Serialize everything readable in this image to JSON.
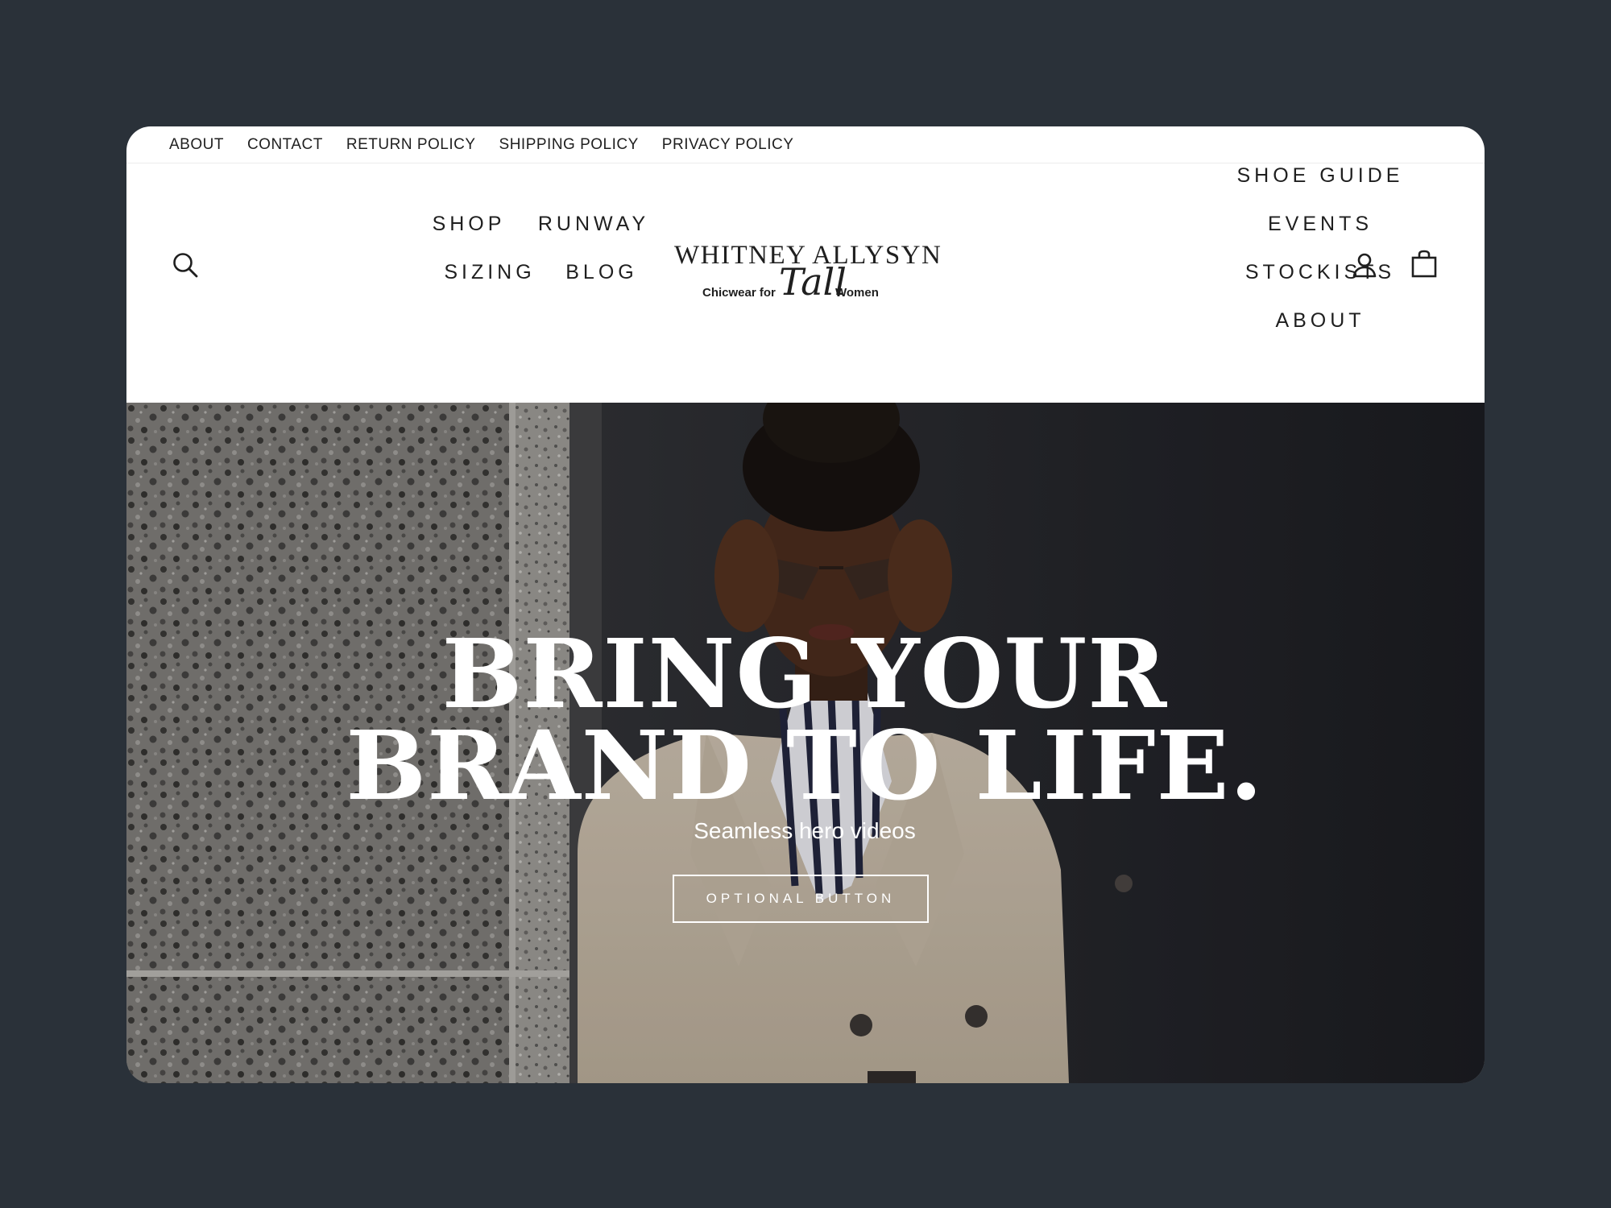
{
  "utility_nav": {
    "items": [
      "ABOUT",
      "CONTACT",
      "RETURN POLICY",
      "SHIPPING POLICY",
      "PRIVACY POLICY"
    ]
  },
  "header": {
    "left_nav": [
      "SHOP",
      "RUNWAY",
      "SIZING",
      "BLOG"
    ],
    "right_nav": [
      "SHOE GUIDE",
      "EVENTS",
      "STOCKISTS",
      "ABOUT"
    ],
    "logo": {
      "name": "WHITNEY ALLYSYN",
      "tagline_left": "Chicwear for",
      "tagline_script": "Tall",
      "tagline_right": "Women"
    },
    "icons": {
      "search": "search-icon",
      "account": "account-icon",
      "cart": "cart-bag-icon"
    }
  },
  "hero": {
    "title_line1": "BRING YOUR",
    "title_line2": "BRAND TO LIFE.",
    "subtitle": "Seamless hero videos",
    "button_label": "OPTIONAL BUTTON"
  },
  "colors": {
    "page_background": "#2a3139",
    "header_background": "#ffffff",
    "text_dark": "#1f1f1f",
    "hero_text": "#ffffff"
  }
}
